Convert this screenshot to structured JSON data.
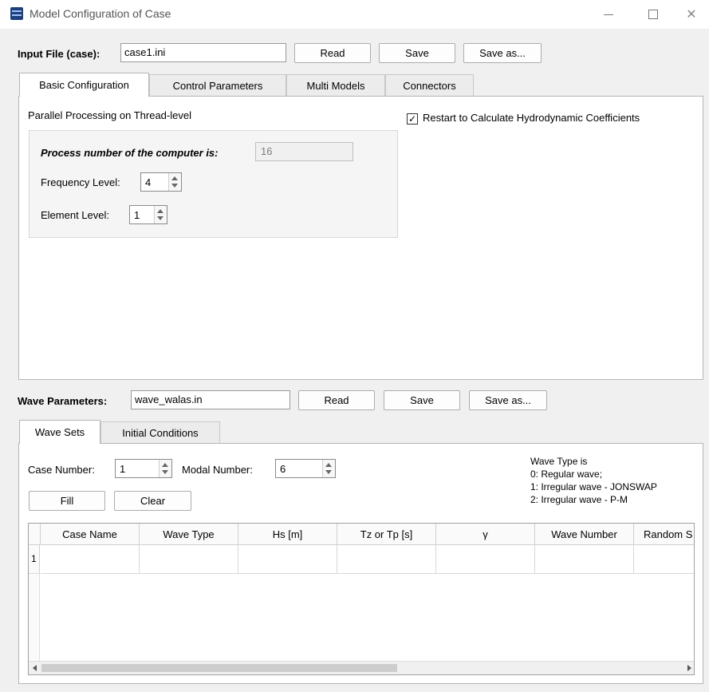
{
  "window": {
    "title": "Model Configuration of Case",
    "controls": {
      "minimize": "—",
      "maximize": "☐",
      "close": "✕"
    }
  },
  "input_file": {
    "label": "Input File (case):",
    "value": "case1.ini",
    "read": "Read",
    "save": "Save",
    "save_as": "Save as..."
  },
  "config_tabs": [
    "Basic Configuration",
    "Control Parameters",
    "Multi Models",
    "Connectors"
  ],
  "basic": {
    "parallel_label": "Parallel Processing on Thread-level",
    "restart_label": "Restart to Calculate Hydrodynamic Coefficients",
    "restart_checked": true,
    "check_mark": "✓",
    "process_label": "Process number of the computer is:",
    "process_value": "16",
    "freq_label": "Frequency Level:",
    "freq_value": "4",
    "elem_label": "Element Level:",
    "elem_value": "1"
  },
  "wave_file": {
    "label": "Wave Parameters:",
    "value": "wave_walas.in",
    "read": "Read",
    "save": "Save",
    "save_as": "Save as..."
  },
  "wave_tabs": [
    "Wave Sets",
    "Initial Conditions"
  ],
  "wave_sets": {
    "case_number_label": "Case Number:",
    "case_number_value": "1",
    "modal_number_label": "Modal Number:",
    "modal_number_value": "6",
    "fill": "Fill",
    "clear": "Clear",
    "wave_type_info": [
      "Wave Type is",
      "0: Regular wave;",
      "1: Irregular wave - JONSWAP",
      "2: Irregular wave - P-M"
    ],
    "columns": [
      "Case Name",
      "Wave Type",
      "Hs [m]",
      "Tz or Tp [s]",
      "γ",
      "Wave Number",
      "Random S"
    ],
    "row_numbers": [
      "1"
    ]
  }
}
